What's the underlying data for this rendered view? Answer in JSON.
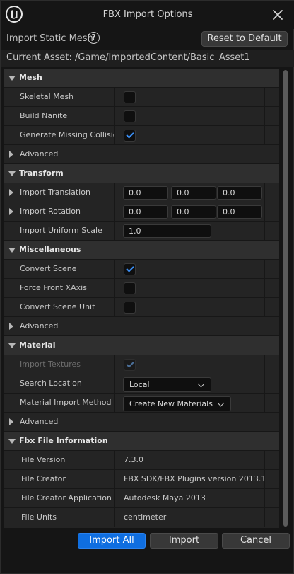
{
  "window": {
    "title": "FBX Import Options"
  },
  "header": {
    "import_label": "Import Static Mesh",
    "help_glyph": "?",
    "reset_label": "Reset to Default"
  },
  "asset": {
    "label": "Current Asset:  /Game/ImportedContent/Basic_Asset1"
  },
  "sections": {
    "mesh": {
      "title": "Mesh",
      "skeletal_mesh": {
        "label": "Skeletal Mesh",
        "checked": false
      },
      "build_nanite": {
        "label": "Build Nanite",
        "checked": false
      },
      "generate_collision": {
        "label": "Generate Missing Collision",
        "checked": true
      },
      "advanced": "Advanced"
    },
    "transform": {
      "title": "Transform",
      "translation": {
        "label": "Import Translation",
        "x": "0.0",
        "y": "0.0",
        "z": "0.0"
      },
      "rotation": {
        "label": "Import Rotation",
        "x": "0.0",
        "y": "0.0",
        "z": "0.0"
      },
      "scale": {
        "label": "Import Uniform Scale",
        "value": "1.0"
      }
    },
    "misc": {
      "title": "Miscellaneous",
      "convert_scene": {
        "label": "Convert Scene",
        "checked": true
      },
      "force_front_xaxis": {
        "label": "Force Front XAxis",
        "checked": false
      },
      "convert_scene_unit": {
        "label": "Convert Scene Unit",
        "checked": false
      },
      "advanced": "Advanced"
    },
    "material": {
      "title": "Material",
      "import_textures": {
        "label": "Import Textures",
        "checked": true,
        "enabled": false
      },
      "search_location": {
        "label": "Search Location",
        "value": "Local"
      },
      "import_method": {
        "label": "Material Import Method",
        "value": "Create New Materials"
      },
      "advanced": "Advanced"
    },
    "fbx_info": {
      "title": "Fbx File Information",
      "file_version": {
        "label": "File Version",
        "value": "7.3.0"
      },
      "file_creator": {
        "label": "File Creator",
        "value": "FBX SDK/FBX Plugins version 2013.1"
      },
      "creator_app": {
        "label": "File Creator Application",
        "value": "Autodesk Maya 2013"
      },
      "file_units": {
        "label": "File Units",
        "value": "centimeter"
      }
    }
  },
  "footer": {
    "import_all": "Import All",
    "import": "Import",
    "cancel": "Cancel"
  },
  "colors": {
    "accent": "#0f6ee0",
    "check": "#3b8ff5",
    "background": "#151515",
    "panel": "#242424",
    "category": "#2f2f2f"
  },
  "icons": [
    "unreal-logo-icon",
    "close-icon",
    "help-icon",
    "expand-arrow-icon",
    "collapse-arrow-icon",
    "checkmark-icon",
    "dropdown-chevron-icon"
  ]
}
